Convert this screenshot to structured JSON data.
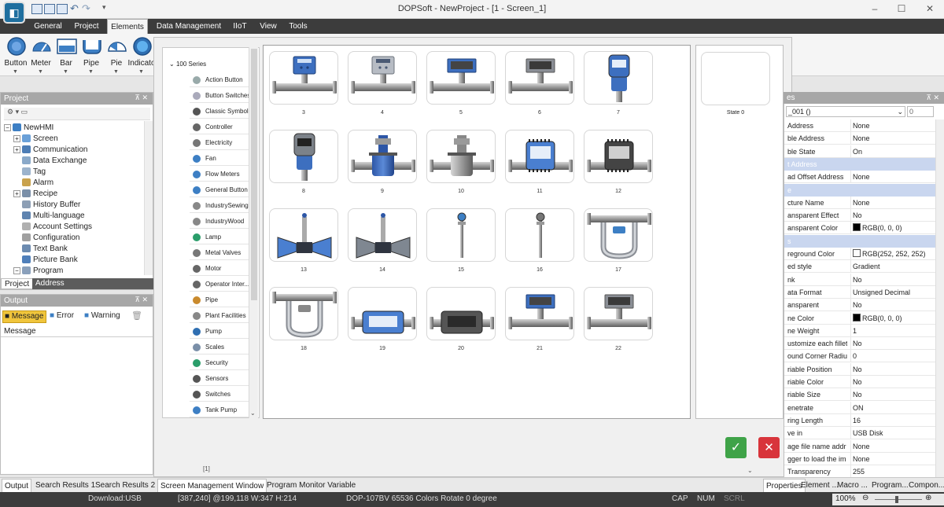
{
  "window": {
    "title": "DOPSoft - NewProject - [1 - Screen_1]",
    "controls": [
      "–",
      "☐",
      "✕"
    ]
  },
  "menu_tabs": [
    "General",
    "Project",
    "Elements",
    "Data Management",
    "IIoT",
    "View",
    "Tools"
  ],
  "ribbon": {
    "buttons": [
      "Button",
      "Meter",
      "Bar",
      "Pipe",
      "Pie",
      "Indicato"
    ]
  },
  "project_panel": {
    "title": "Project",
    "root": "NewHMI",
    "items": [
      "Screen",
      "Communication",
      "Data Exchange",
      "Tag",
      "Alarm",
      "Recipe",
      "History Buffer",
      "Multi-language",
      "Account Settings",
      "Configuration",
      "Text Bank",
      "Picture Bank",
      "Program"
    ],
    "tabs": [
      "Project",
      "Address"
    ]
  },
  "output_panel": {
    "title": "Output",
    "filters": [
      "Message",
      "Error",
      "Warning"
    ],
    "column": "Message"
  },
  "library": {
    "group": "100 Series",
    "items": [
      "Action Button",
      "Button Switches",
      "Classic Symbol",
      "Controller",
      "Electricity",
      "Fan",
      "Flow Meters",
      "General Button",
      "IndustrySewing",
      "IndustryWood",
      "Lamp",
      "Metal Valves",
      "Motor",
      "Operator Inter...",
      "Pipe",
      "Plant Facilities",
      "Pump",
      "Scales",
      "Security",
      "Sensors",
      "Switches",
      "Tank Pump"
    ],
    "pager": "[1]"
  },
  "gallery": {
    "items": [
      "3",
      "4",
      "5",
      "6",
      "7",
      "8",
      "9",
      "10",
      "11",
      "12",
      "13",
      "14",
      "15",
      "16",
      "17",
      "18",
      "19",
      "20",
      "21",
      "22"
    ]
  },
  "state": {
    "label": "State 0"
  },
  "properties": {
    "title": "es",
    "object": "_001 ()",
    "spinner": "0",
    "rows": [
      {
        "name": "Address",
        "value": "None"
      },
      {
        "name": "ble Address",
        "value": "None"
      },
      {
        "name": "ble State",
        "value": "On"
      },
      {
        "section": "t Address"
      },
      {
        "name": "ad Offset Address",
        "value": "None"
      },
      {
        "section": "e"
      },
      {
        "name": "cture Name",
        "value": "None"
      },
      {
        "name": "ansparent Effect",
        "value": "No"
      },
      {
        "name": "ansparent Color",
        "value": "RGB(0, 0, 0)",
        "swatch": "#000000"
      },
      {
        "section": "s"
      },
      {
        "name": "reground Color",
        "value": "RGB(252, 252, 252)",
        "swatch": "#fcfcfc"
      },
      {
        "name": "ed style",
        "value": "Gradient"
      },
      {
        "name": "nk",
        "value": "No"
      },
      {
        "name": "ata Format",
        "value": "Unsigned Decimal"
      },
      {
        "name": "ansparent",
        "value": "No"
      },
      {
        "name": "ne Color",
        "value": "RGB(0, 0, 0)",
        "swatch": "#000000"
      },
      {
        "name": "ne Weight",
        "value": "1"
      },
      {
        "name": "ustomize each fillet r",
        "value": "No"
      },
      {
        "name": "ound Corner Radius",
        "value": "0"
      },
      {
        "name": "riable Position",
        "value": "No"
      },
      {
        "name": "riable Color",
        "value": "No"
      },
      {
        "name": "riable Size",
        "value": "No"
      },
      {
        "name": "enetrate",
        "value": "ON"
      },
      {
        "name": "ring Length",
        "value": "16"
      },
      {
        "name": "ve in",
        "value": "USB Disk"
      },
      {
        "name": "age file name addr",
        "value": "None"
      },
      {
        "name": "gger to load the im",
        "value": "None"
      },
      {
        "name": "Transparency",
        "value": "255"
      }
    ]
  },
  "bottom_tabs": {
    "left": [
      "Output",
      "Search Results 1",
      "Search Results 2"
    ],
    "center": [
      "Screen Management Window",
      "Program Monitor Variable"
    ],
    "right": [
      "Properties",
      "Element ...",
      "Macro ...",
      "Program...",
      "Compon..."
    ]
  },
  "status": {
    "download": "Download:USB",
    "position": "[387,240] @199,118 W:347 H:214",
    "device": "DOP-107BV 65536 Colors Rotate 0 degree",
    "cap": "CAP",
    "num": "NUM",
    "scrl": "SCRL",
    "zoom": "100%"
  },
  "colors": {
    "accent_blue": "#3d7fc4",
    "ok_green": "#3fa348",
    "cancel_red": "#d8343b",
    "status_bg": "#3c3c3c"
  },
  "icons": {
    "ok": "✓",
    "cancel": "✕"
  }
}
